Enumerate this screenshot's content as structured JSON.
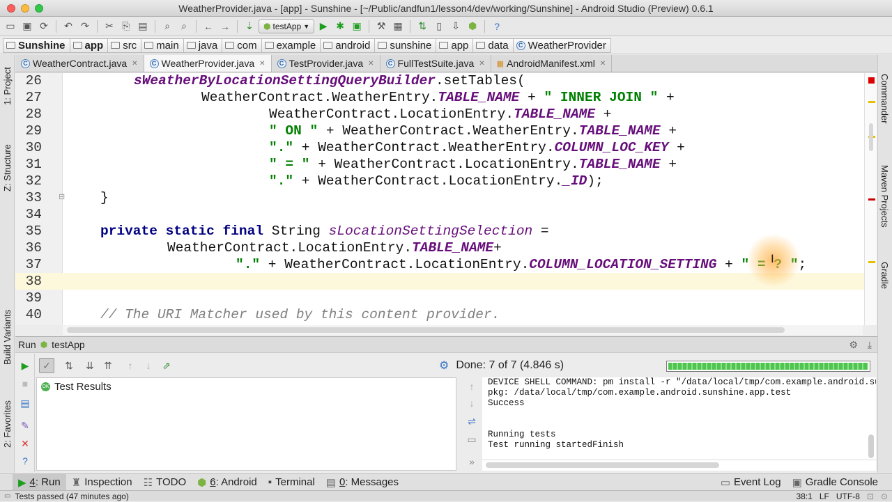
{
  "window": {
    "title": "WeatherProvider.java - [app] - Sunshine - [~/Public/andfun1/lesson4/dev/working/Sunshine] - Android Studio (Preview) 0.6.1",
    "colors": {
      "close": "#fc605c",
      "minimize": "#fdbc40",
      "zoom": "#34c84a"
    }
  },
  "toolbar": {
    "run_config": "testApp"
  },
  "breadcrumb": [
    "Sunshine",
    "app",
    "src",
    "main",
    "java",
    "com",
    "example",
    "android",
    "sunshine",
    "app",
    "data",
    "WeatherProvider"
  ],
  "left_tabs": {
    "project": "1: Project",
    "structure": "Z: Structure",
    "build_variants": "Build Variants",
    "favorites": "2: Favorites"
  },
  "right_tabs": {
    "commander": "Commander",
    "maven": "Maven Projects",
    "gradle": "Gradle"
  },
  "editor_tabs": [
    {
      "label": "WeatherContract.java"
    },
    {
      "label": "WeatherProvider.java"
    },
    {
      "label": "TestProvider.java"
    },
    {
      "label": "FullTestSuite.java"
    },
    {
      "label": "AndroidManifest.xml"
    }
  ],
  "code": {
    "line_numbers": [
      "26",
      "27",
      "28",
      "29",
      "30",
      "31",
      "32",
      "33",
      "34",
      "35",
      "36",
      "37",
      "38",
      "39",
      "40"
    ],
    "l26": {
      "fld": "sWeatherByLocationSettingQueryBuilder",
      "rest": ".setTables("
    },
    "l27": {
      "a": "WeatherContract.WeatherEntry.",
      "fld": "TABLE_NAME",
      "b": " + ",
      "str": "\" INNER JOIN \"",
      "c": " +"
    },
    "l28": {
      "a": "WeatherContract.LocationEntry.",
      "fld": "TABLE_NAME",
      "c": " +"
    },
    "l29": {
      "str": "\" ON \"",
      "a": " + WeatherContract.WeatherEntry.",
      "fld": "TABLE_NAME",
      "c": " +"
    },
    "l30": {
      "str": "\".\"",
      "a": " + WeatherContract.WeatherEntry.",
      "fld": "COLUMN_LOC_KEY",
      "c": " +"
    },
    "l31": {
      "str": "\" = \"",
      "a": " + WeatherContract.LocationEntry.",
      "fld": "TABLE_NAME",
      "c": " +"
    },
    "l32": {
      "str": "\".\"",
      "a": " + WeatherContract.LocationEntry.",
      "fld": "_ID",
      "c": ");"
    },
    "l33": {
      "a": "}"
    },
    "l35": {
      "kw": "private static final",
      "a": " String ",
      "sfld": "sLocationSettingSelection",
      "c": " ="
    },
    "l36": {
      "a": "WeatherContract.LocationEntry.",
      "fld": "TABLE_NAME",
      "c": "+"
    },
    "l37": {
      "str": "\".\"",
      "a": " + WeatherContract.LocationEntry.",
      "fld": "COLUMN_LOCATION_SETTING",
      "b": " + ",
      "str2": "\" = ? \"",
      "c": ";"
    },
    "l40": {
      "cmt": "// The URI Matcher used by this content provider."
    }
  },
  "run_panel": {
    "title": "Run",
    "config": "testApp",
    "tree_root": "Test Results",
    "status": "Done: 7 of 7  (4.846 s)",
    "progress": 1.0
  },
  "console": [
    "DEVICE SHELL COMMAND: pm install -r \"/data/local/tmp/com.example.android.suns",
    "pkg: /data/local/tmp/com.example.android.sunshine.app.test",
    "Success",
    "",
    "",
    "Running tests",
    "Test running startedFinish"
  ],
  "bottom_tabs": {
    "run": {
      "num": "4",
      "label": ": Run"
    },
    "inspection": "Inspection",
    "todo": "TODO",
    "android": {
      "num": "6",
      "label": ": Android"
    },
    "terminal": "Terminal",
    "messages": {
      "num": "0",
      "label": ": Messages"
    },
    "event_log": "Event Log",
    "gradle_console": "Gradle Console"
  },
  "statusbar": {
    "message": "Tests passed (47 minutes ago)",
    "position": "38:1",
    "line_sep": "LF",
    "encoding": "UTF-8"
  }
}
